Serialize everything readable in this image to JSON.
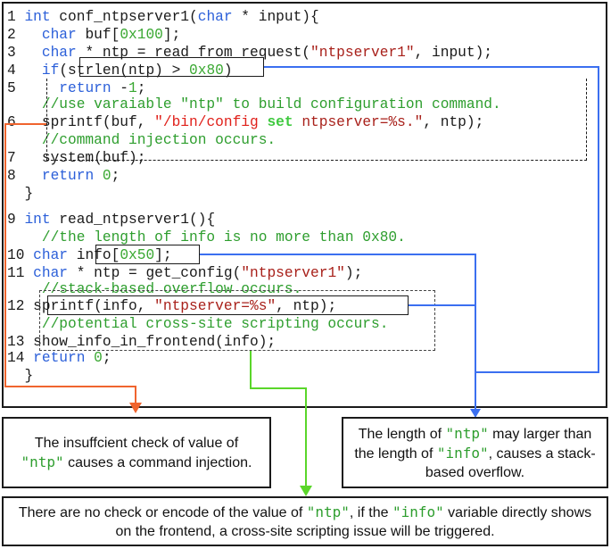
{
  "colors": {
    "keyword": "#2b5fd9",
    "number": "#3aa832",
    "string": "#a8201a",
    "comment": "#2e9e2e",
    "arrow_command_injection": "#f0642e",
    "arrow_stack_overflow": "#3b6ff0",
    "arrow_xss": "#5ad62a"
  },
  "code": {
    "lines": [
      {
        "num": "1",
        "parts": [
          {
            "t": "int",
            "c": "kw"
          },
          {
            "t": " conf_ntpserver1(",
            "c": ""
          },
          {
            "t": "char",
            "c": "kw"
          },
          {
            "t": " * input){",
            "c": ""
          }
        ]
      },
      {
        "num": "2",
        "parts": [
          {
            "t": "  ",
            "c": ""
          },
          {
            "t": "char",
            "c": "kw"
          },
          {
            "t": " buf[",
            "c": ""
          },
          {
            "t": "0x100",
            "c": "num"
          },
          {
            "t": "];",
            "c": ""
          }
        ]
      },
      {
        "num": "3",
        "parts": [
          {
            "t": "  ",
            "c": ""
          },
          {
            "t": "char",
            "c": "kw"
          },
          {
            "t": " * ntp = read_from_request(",
            "c": ""
          },
          {
            "t": "\"ntpserver1\"",
            "c": "str"
          },
          {
            "t": ", input);",
            "c": ""
          }
        ]
      },
      {
        "num": "4",
        "parts": [
          {
            "t": "  ",
            "c": ""
          },
          {
            "t": "if",
            "c": "kw"
          },
          {
            "t": "(strlen(ntp) > ",
            "c": ""
          },
          {
            "t": "0x80",
            "c": "num"
          },
          {
            "t": ")",
            "c": ""
          }
        ]
      },
      {
        "num": "5",
        "parts": [
          {
            "t": "    ",
            "c": ""
          },
          {
            "t": "return",
            "c": "kw"
          },
          {
            "t": " -",
            "c": ""
          },
          {
            "t": "1",
            "c": "num"
          },
          {
            "t": ";",
            "c": ""
          }
        ]
      },
      {
        "num": "",
        "parts": [
          {
            "t": "  //use varaiable \"ntp\" to build configuration command.",
            "c": "cm"
          }
        ]
      },
      {
        "num": "6",
        "parts": [
          {
            "t": "  sprintf(buf, ",
            "c": ""
          },
          {
            "t": "\"/bin/config ",
            "c": "str2"
          },
          {
            "t": "set",
            "c": "kwb"
          },
          {
            "t": " ntpserver=%s.\"",
            "c": "str"
          },
          {
            "t": ", ntp);",
            "c": ""
          }
        ]
      },
      {
        "num": "",
        "parts": [
          {
            "t": "  //command injection occurs.",
            "c": "cm"
          }
        ]
      },
      {
        "num": "7",
        "parts": [
          {
            "t": "  system(buf);",
            "c": ""
          }
        ]
      },
      {
        "num": "8",
        "parts": [
          {
            "t": "  ",
            "c": ""
          },
          {
            "t": "return",
            "c": "kw"
          },
          {
            "t": " ",
            "c": ""
          },
          {
            "t": "0",
            "c": "num"
          },
          {
            "t": ";",
            "c": ""
          }
        ]
      },
      {
        "num": "",
        "parts": [
          {
            "t": "}",
            "c": ""
          }
        ]
      },
      {
        "num": "9",
        "parts": [
          {
            "t": "int",
            "c": "kw"
          },
          {
            "t": " read_ntpserver1(){",
            "c": ""
          }
        ]
      },
      {
        "num": "",
        "parts": [
          {
            "t": "  //the length of info is no more than 0x80.",
            "c": "cm"
          }
        ]
      },
      {
        "num": "10",
        "parts": [
          {
            "t": "char",
            "c": "kw"
          },
          {
            "t": " info[",
            "c": ""
          },
          {
            "t": "0x50",
            "c": "num"
          },
          {
            "t": "];",
            "c": ""
          }
        ]
      },
      {
        "num": "11",
        "parts": [
          {
            "t": "char",
            "c": "kw"
          },
          {
            "t": " * ntp = get_config(",
            "c": ""
          },
          {
            "t": "\"ntpserver1\"",
            "c": "str"
          },
          {
            "t": ");",
            "c": ""
          }
        ]
      },
      {
        "num": "",
        "parts": [
          {
            "t": "  //stack-based overflow occurs.",
            "c": "cm"
          }
        ]
      },
      {
        "num": "12",
        "parts": [
          {
            "t": "sprintf(info, ",
            "c": ""
          },
          {
            "t": "\"ntpserver=%s\"",
            "c": "str"
          },
          {
            "t": ", ntp);",
            "c": ""
          }
        ]
      },
      {
        "num": "",
        "parts": [
          {
            "t": "  //potential cross-site scripting occurs.",
            "c": "cm"
          }
        ]
      },
      {
        "num": "13",
        "parts": [
          {
            "t": "show_info_in_frontend(info);",
            "c": ""
          }
        ]
      },
      {
        "num": "14",
        "parts": [
          {
            "t": "return",
            "c": "kw"
          },
          {
            "t": " ",
            "c": ""
          },
          {
            "t": "0",
            "c": "num"
          },
          {
            "t": ";",
            "c": ""
          }
        ]
      },
      {
        "num": "",
        "parts": [
          {
            "t": "}",
            "c": ""
          }
        ]
      }
    ]
  },
  "notes": {
    "command_injection": {
      "before": "The insuffcient check of value of ",
      "var1": "\"ntp\"",
      "after": " causes a command injection."
    },
    "stack_overflow": {
      "before": "The length of ",
      "var1": "\"ntp\"",
      "middle": "  may larger than the length of ",
      "var2": "\"info\"",
      "after": ", causes a stack-based overflow."
    },
    "xss": {
      "before": "There are no check or encode of the value of ",
      "var1": "\"ntp\"",
      "middle": ", if the ",
      "var2": "\"info\"",
      "after": " variable directly shows on the frontend, a cross-site scripting issue will be triggered."
    }
  }
}
